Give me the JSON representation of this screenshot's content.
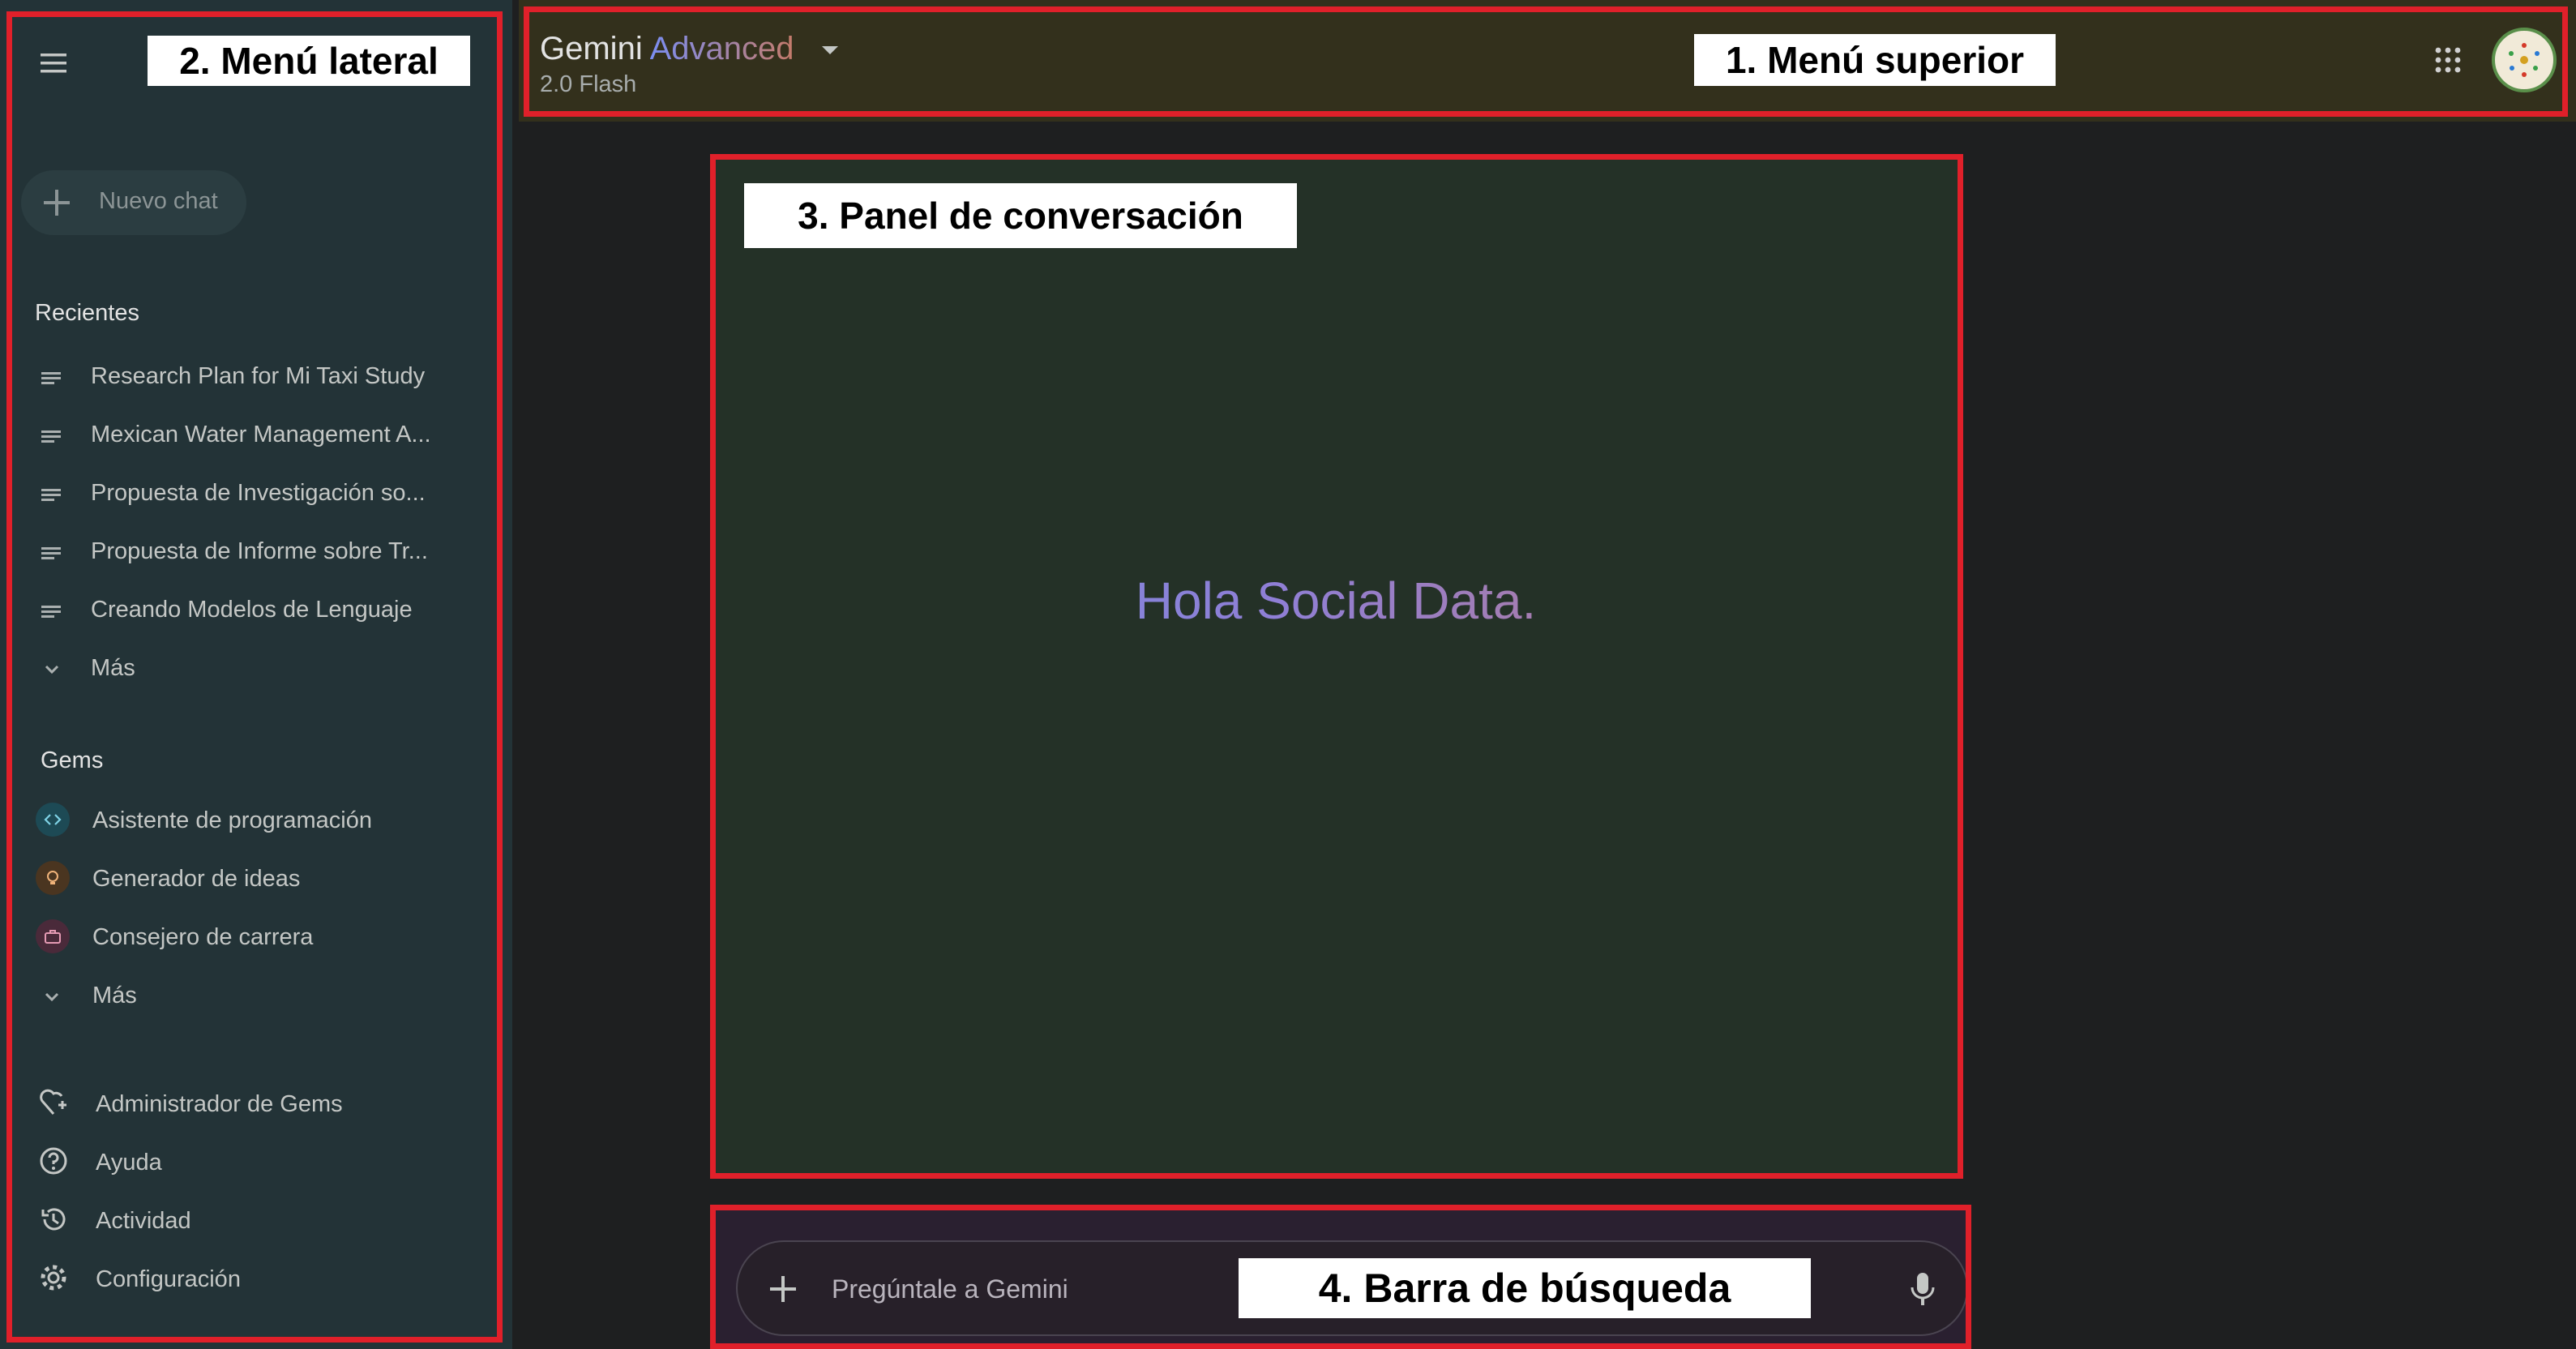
{
  "annotations": {
    "top_menu": "1. Menú superior",
    "side_menu": "2. Menú lateral",
    "conversation_panel": "3. Panel de conversación",
    "search_bar": "4. Barra de búsqueda"
  },
  "header": {
    "brand": "Gemini",
    "tier": "Advanced",
    "model": "2.0 Flash"
  },
  "sidebar": {
    "new_chat": "Nuevo chat",
    "recents_title": "Recientes",
    "recents": [
      "Research Plan for Mi Taxi Study",
      "Mexican Water Management A...",
      "Propuesta de Investigación so...",
      "Propuesta de Informe sobre Tr...",
      "Creando Modelos de Lenguaje"
    ],
    "recents_more": "Más",
    "gems_title": "Gems",
    "gems": [
      "Asistente de programación",
      "Generador de ideas",
      "Consejero de carrera"
    ],
    "gems_more": "Más",
    "footer": [
      "Administrador de Gems",
      "Ayuda",
      "Actividad",
      "Configuración"
    ]
  },
  "main": {
    "greeting": "Hola Social Data.",
    "input_placeholder": "Pregúntale a Gemini"
  },
  "colors": {
    "annotation_red": "#e0202a",
    "sidebar_bg": "#233337",
    "topbar_bg": "#33301c",
    "conversation_bg": "#243127",
    "searchbar_bg": "#2a2030"
  }
}
